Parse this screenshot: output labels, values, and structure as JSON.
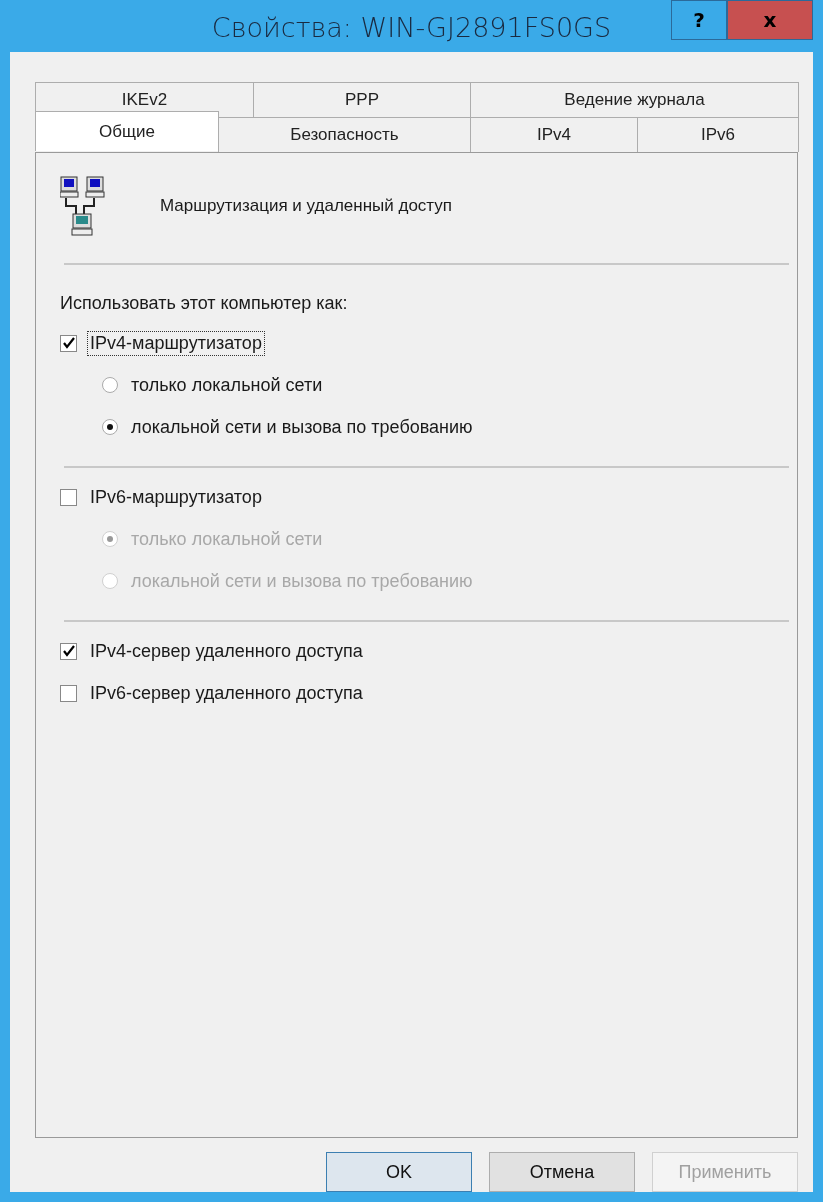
{
  "window": {
    "title": "Свойства: WIN-GJ2891FS0GS",
    "help_button": "?",
    "close_button": "x"
  },
  "tabs": [
    [
      {
        "label": "IKEv2",
        "selected": false
      },
      {
        "label": "PPP",
        "selected": false
      },
      {
        "label": "Ведение журнала",
        "selected": false
      }
    ],
    [
      {
        "label": "Общие",
        "selected": true
      },
      {
        "label": "Безопасность",
        "selected": false
      },
      {
        "label": "IPv4",
        "selected": false
      },
      {
        "label": "IPv6",
        "selected": false
      }
    ]
  ],
  "header": {
    "text": "Маршрутизация и удаленный доступ"
  },
  "group_label": "Использовать этот компьютер как:",
  "sections": [
    {
      "items": [
        {
          "kind": "checkbox",
          "label": "IPv4-маршрутизатор",
          "checked": true,
          "focused": true,
          "radios": [
            {
              "label": "только локальной сети",
              "selected": false,
              "disabled": false
            },
            {
              "label": "локальной сети и вызова по требованию",
              "selected": true,
              "disabled": false
            }
          ]
        }
      ]
    },
    {
      "items": [
        {
          "kind": "checkbox",
          "label": "IPv6-маршрутизатор",
          "checked": false,
          "focused": false,
          "radios": [
            {
              "label": "только локальной сети",
              "selected": true,
              "disabled": true
            },
            {
              "label": "локальной сети и вызова по требованию",
              "selected": false,
              "disabled": true
            }
          ]
        }
      ]
    },
    {
      "items": [
        {
          "kind": "checkbox",
          "label": "IPv4-сервер удаленного доступа",
          "checked": true,
          "focused": false
        },
        {
          "kind": "checkbox",
          "label": "IPv6-сервер удаленного доступа",
          "checked": false,
          "focused": false
        }
      ]
    }
  ],
  "buttons": [
    {
      "label": "OK",
      "default": true,
      "disabled": false
    },
    {
      "label": "Отмена",
      "default": false,
      "disabled": false
    },
    {
      "label": "Применить",
      "default": false,
      "disabled": true
    }
  ]
}
